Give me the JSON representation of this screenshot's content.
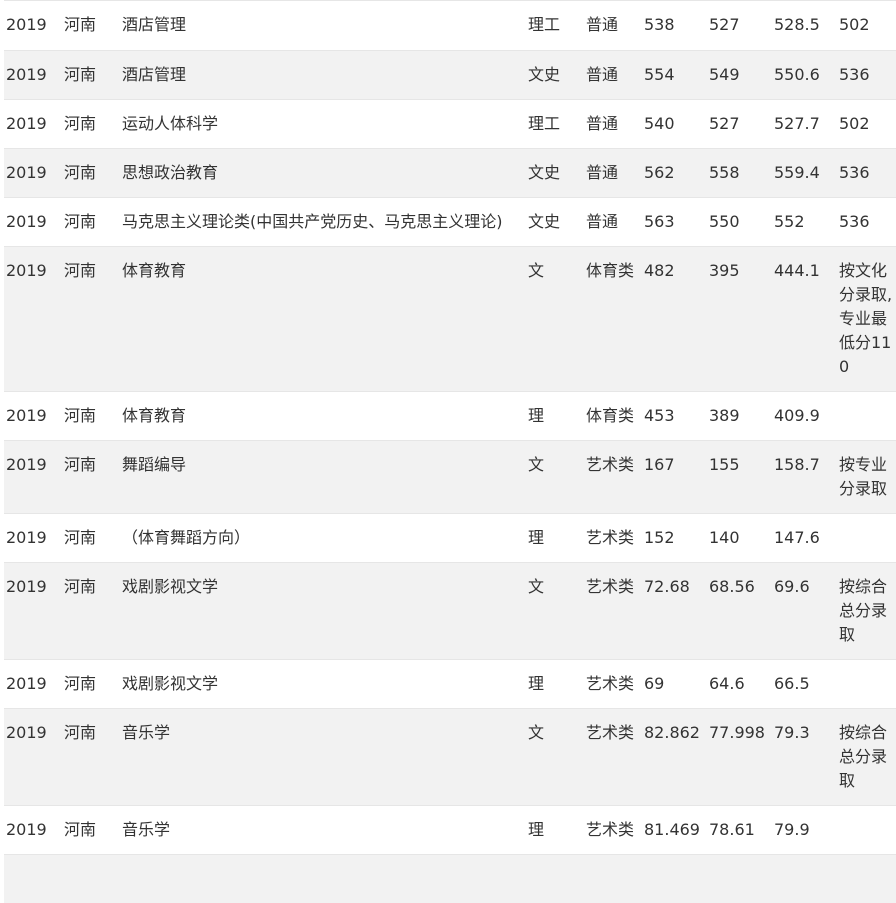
{
  "rows": [
    [
      "2019",
      "河南",
      "酒店管理",
      "理工",
      "普通",
      "538",
      "527",
      "528.5",
      "502"
    ],
    [
      "2019",
      "河南",
      "酒店管理",
      "文史",
      "普通",
      "554",
      "549",
      "550.6",
      "536"
    ],
    [
      "2019",
      "河南",
      "运动人体科学",
      "理工",
      "普通",
      "540",
      "527",
      "527.7",
      "502"
    ],
    [
      "2019",
      "河南",
      "思想政治教育",
      "文史",
      "普通",
      "562",
      "558",
      "559.4",
      "536"
    ],
    [
      "2019",
      "河南",
      "马克思主义理论类(中国共产党历史、马克思主义理论)",
      "文史",
      "普通",
      "563",
      "550",
      "552",
      "536"
    ],
    [
      "2019",
      "河南",
      "体育教育",
      "文",
      "体育类",
      "482",
      "395",
      "444.1",
      "按文化分录取,专业最低分110"
    ],
    [
      "2019",
      "河南",
      "体育教育",
      "理",
      "体育类",
      "453",
      "389",
      "409.9",
      ""
    ],
    [
      "2019",
      "河南",
      "舞蹈编导",
      "文",
      "艺术类",
      "167",
      "155",
      "158.7",
      "按专业分录取"
    ],
    [
      "2019",
      "河南",
      "（体育舞蹈方向）",
      "理",
      "艺术类",
      "152",
      "140",
      "147.6",
      ""
    ],
    [
      "2019",
      "河南",
      "戏剧影视文学",
      "文",
      "艺术类",
      "72.68",
      "68.56",
      "69.6",
      "按综合总分录取"
    ],
    [
      "2019",
      "河南",
      "戏剧影视文学",
      "理",
      "艺术类",
      "69",
      "64.6",
      "66.5",
      ""
    ],
    [
      "2019",
      "河南",
      "音乐学",
      "文",
      "艺术类",
      "82.862",
      "77.998",
      "79.3",
      "按综合总分录取"
    ],
    [
      "2019",
      "河南",
      "音乐学",
      "理",
      "艺术类",
      "81.469",
      "78.61",
      "79.9",
      ""
    ]
  ]
}
